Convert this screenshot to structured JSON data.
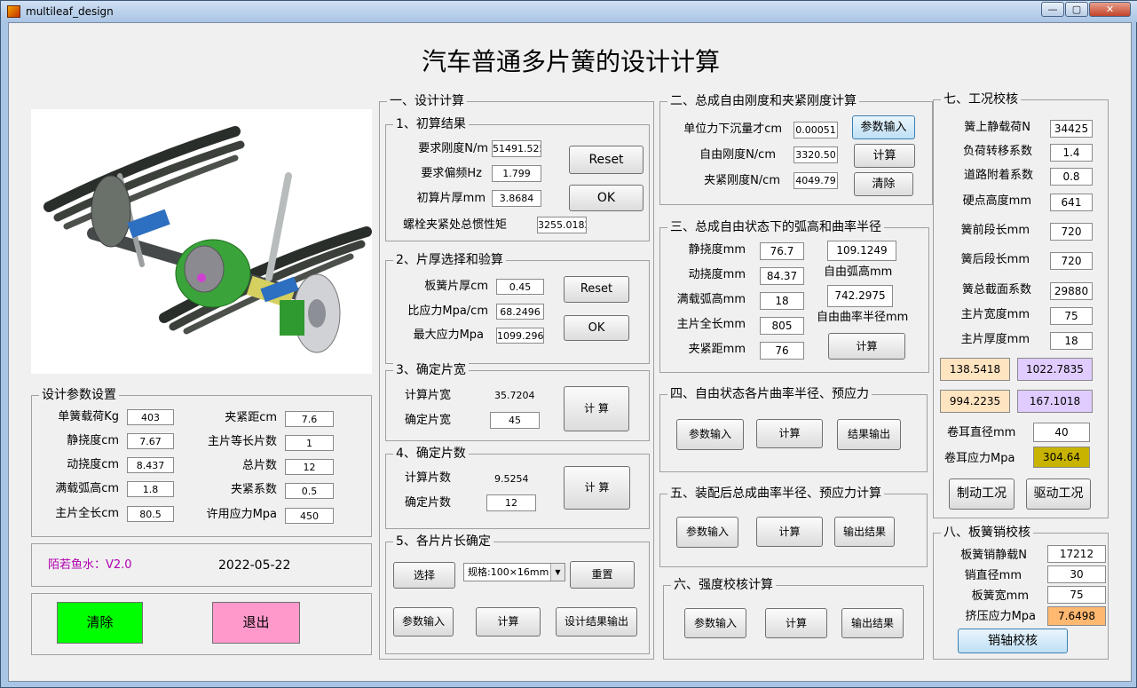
{
  "window": {
    "title": "multileaf_design",
    "minimize": "—",
    "maximize": "▢",
    "close": "✕"
  },
  "colors": {
    "green": "#00ff00",
    "pink": "#ff99cc",
    "beige": "#ffe4c0",
    "lavender": "#e0ccff",
    "olive": "#c8b400",
    "orange": "#ffb870",
    "purple": "#b000b0"
  },
  "main_title": "汽车普通多片簧的设计计算",
  "image": {
    "alt_icon": "leaf-spring-suspension-illustration"
  },
  "params": {
    "title": "设计参数设置",
    "left": [
      {
        "label": "单簧载荷Kg",
        "value": "403"
      },
      {
        "label": "静挠度cm",
        "value": "7.67"
      },
      {
        "label": "动挠度cm",
        "value": "8.437"
      },
      {
        "label": "满载弧高cm",
        "value": "1.8"
      },
      {
        "label": "主片全长cm",
        "value": "80.5"
      }
    ],
    "right": [
      {
        "label": "夹紧距cm",
        "value": "7.6"
      },
      {
        "label": "主片等长片数",
        "value": "1"
      },
      {
        "label": "总片数",
        "value": "12"
      },
      {
        "label": "夹紧系数",
        "value": "0.5"
      },
      {
        "label": "许用应力Mpa",
        "value": "450"
      }
    ]
  },
  "footer": {
    "author": "陌若鱼水：V2.0",
    "date": "2022-05-22",
    "clear": "清除",
    "exit": "退出"
  },
  "s1": {
    "title": "一、设计计算",
    "sub1": {
      "title": "1、初算结果",
      "rows": [
        {
          "label": "要求刚度N/m",
          "value": "51491.525"
        },
        {
          "label": "要求偏频Hz",
          "value": "1.799"
        },
        {
          "label": "初算片厚mm",
          "value": "3.8684"
        }
      ],
      "bolt_label": "螺栓夹紧处总惯性矩",
      "bolt_value": "3255.0182",
      "reset": "Reset",
      "ok": "OK"
    },
    "sub2": {
      "title": "2、片厚选择和验算",
      "rows": [
        {
          "label": "板簧片厚cm",
          "value": "0.45"
        },
        {
          "label": "比应力Mpa/cm",
          "value": "68.2496"
        },
        {
          "label": "最大应力Mpa",
          "value": "1099.2966"
        }
      ],
      "reset": "Reset",
      "ok": "OK"
    },
    "sub3": {
      "title": "3、确定片宽",
      "calc_label": "计算片宽",
      "calc_value": "35.7204",
      "set_label": "确定片宽",
      "set_value": "45",
      "button": "计 算"
    },
    "sub4": {
      "title": "4、确定片数",
      "calc_label": "计算片数",
      "calc_value": "9.5254",
      "set_label": "确定片数",
      "set_value": "12",
      "button": "计 算"
    },
    "sub5": {
      "title": "5、各片片长确定",
      "select": "选择",
      "spec": "规格:100×16mm",
      "reset": "重置",
      "input": "参数输入",
      "calc": "计算",
      "output": "设计结果输出"
    }
  },
  "s2": {
    "title": "二、总成自由刚度和夹紧刚度计算",
    "rows": [
      {
        "label": "单位力下沉量才cm",
        "value": "0.00051"
      },
      {
        "label": "自由刚度N/cm",
        "value": "3320.50"
      },
      {
        "label": "夹紧刚度N/cm",
        "value": "4049.79"
      }
    ],
    "input": "参数输入",
    "calc": "计算",
    "clear": "清除"
  },
  "s3": {
    "title": "三、总成自由状态下的弧高和曲率半径",
    "rows": [
      {
        "label": "静挠度mm",
        "value": "76.7"
      },
      {
        "label": "动挠度mm",
        "value": "84.37"
      },
      {
        "label": "满载弧高mm",
        "value": "18"
      },
      {
        "label": "主片全长mm",
        "value": "805"
      },
      {
        "label": "夹紧距mm",
        "value": "76"
      }
    ],
    "arc_value": "109.1249",
    "arc_label": "自由弧高mm",
    "radius_value": "742.2975",
    "radius_label": "自由曲率半径mm",
    "calc": "计算"
  },
  "s4": {
    "title": "四、自由状态各片曲率半径、预应力",
    "input": "参数输入",
    "calc": "计算",
    "output": "结果输出"
  },
  "s5": {
    "title": "五、装配后总成曲率半径、预应力计算",
    "input": "参数输入",
    "calc": "计算",
    "output": "输出结果"
  },
  "s6": {
    "title": "六、强度校核计算",
    "input": "参数输入",
    "calc": "计算",
    "output": "输出结果"
  },
  "s7": {
    "title": "七、工况校核",
    "rows": [
      {
        "label": "簧上静载荷N",
        "value": "34425"
      },
      {
        "label": "负荷转移系数",
        "value": "1.4"
      },
      {
        "label": "道路附着系数",
        "value": "0.8"
      },
      {
        "label": "硬点高度mm",
        "value": "641"
      },
      {
        "label": "簧前段长mm",
        "value": "720"
      },
      {
        "label": "簧后段长mm",
        "value": "720"
      },
      {
        "label": "簧总截面系数",
        "value": "29880"
      },
      {
        "label": "主片宽度mm",
        "value": "75"
      },
      {
        "label": "主片厚度mm",
        "value": "18"
      }
    ],
    "res1": "138.5418",
    "res2": "1022.7835",
    "res3": "994.2235",
    "res4": "167.1018",
    "ear_d_label": "卷耳直径mm",
    "ear_d_value": "40",
    "ear_s_label": "卷耳应力Mpa",
    "ear_s_value": "304.64",
    "brake": "制动工况",
    "drive": "驱动工况"
  },
  "s8": {
    "title": "八、板簧销校核",
    "rows": [
      {
        "label": "板簧销静载N",
        "value": "17212"
      },
      {
        "label": "销直径mm",
        "value": "30"
      },
      {
        "label": "板簧宽mm",
        "value": "75"
      }
    ],
    "squeeze_label": "挤压应力Mpa",
    "squeeze_value": "7.6498",
    "button": "销轴校核"
  }
}
